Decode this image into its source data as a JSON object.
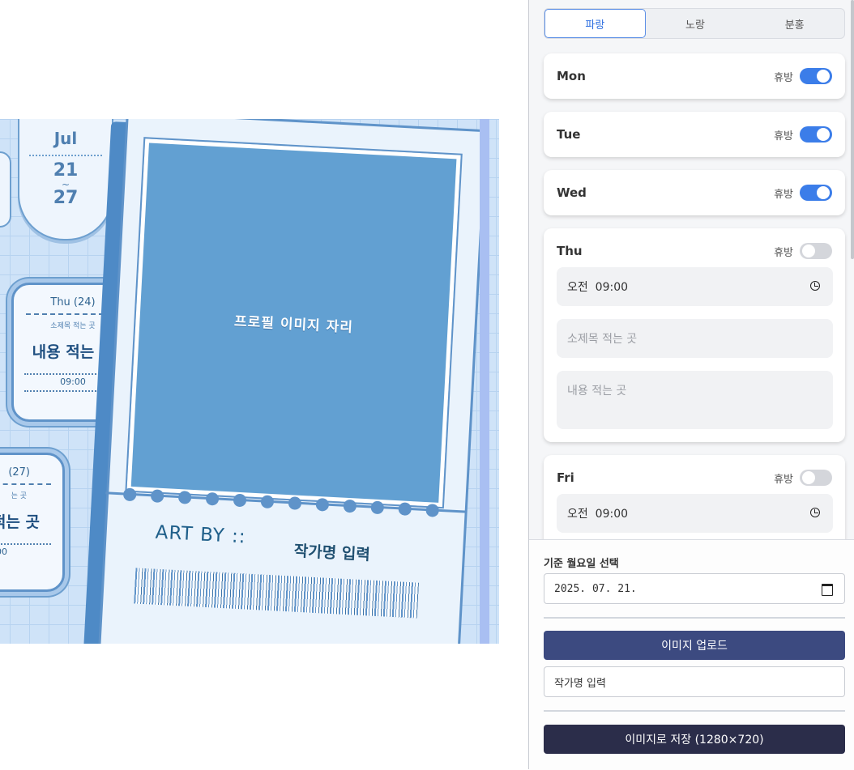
{
  "preview": {
    "month": "Jul",
    "date_start": "21",
    "date_sep": "~",
    "date_end": "27",
    "card_thu": {
      "day": "Thu (24)",
      "subtitle": "소제목 적는 곳",
      "body": "내용 적는 곳",
      "time": "09:00"
    },
    "card_sun": {
      "day": "(27)",
      "subtitle": "는 곳",
      "body": "적는 곳",
      "time": "00"
    },
    "photo_placeholder": "프로필 이미지 자리",
    "art_by": "ART BY ::",
    "artist_name": "작가명 입력"
  },
  "panel": {
    "themes": [
      {
        "label": "파랑",
        "active": true
      },
      {
        "label": "노랑",
        "active": false
      },
      {
        "label": "분홍",
        "active": false
      }
    ],
    "off_label": "휴방",
    "days": [
      {
        "name": "Mon",
        "off": true
      },
      {
        "name": "Tue",
        "off": true
      },
      {
        "name": "Wed",
        "off": true
      },
      {
        "name": "Thu",
        "off": false,
        "time": "오전  09:00",
        "subtitle_placeholder": "소제목 적는 곳",
        "content_placeholder": "내용 적는 곳"
      },
      {
        "name": "Fri",
        "off": false,
        "time": "오전  09:00"
      }
    ],
    "footer": {
      "base_monday_label": "기준 월요일 선택",
      "date_value": "2025. 07. 21.",
      "upload_button": "이미지 업로드",
      "artist_input_value": "작가명 입력",
      "save_button": "이미지로 저장 (1280×720)"
    }
  },
  "colors": {
    "accent": "#3b7de9",
    "upload_button": "#3c4a80",
    "save_button": "#2b2d4a",
    "theme_blue": "#62a0d2"
  }
}
